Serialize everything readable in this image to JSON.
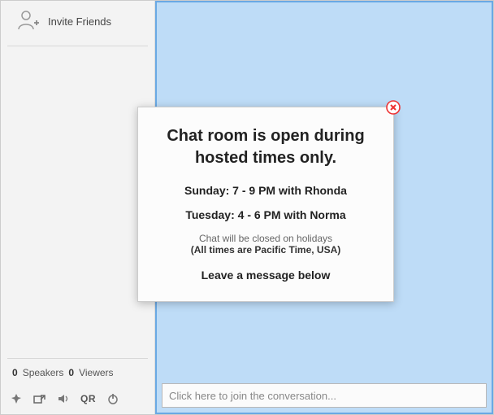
{
  "sidebar": {
    "invite_label": "Invite Friends",
    "counts": {
      "speakers_count": "0",
      "speakers_label": "Speakers",
      "viewers_count": "0",
      "viewers_label": "Viewers"
    },
    "toolbar": {
      "qr_label": "QR"
    }
  },
  "chat": {
    "input_placeholder": "Click here to join the conversation..."
  },
  "modal": {
    "heading": "Chat room is open during hosted times only.",
    "schedule": [
      "Sunday: 7 - 9 PM with Rhonda",
      "Tuesday: 4 - 6 PM with Norma"
    ],
    "closed_note": "Chat will be closed on holidays",
    "timezone_note": "(All times are Pacific Time, USA)",
    "leave_message": "Leave a message below"
  }
}
